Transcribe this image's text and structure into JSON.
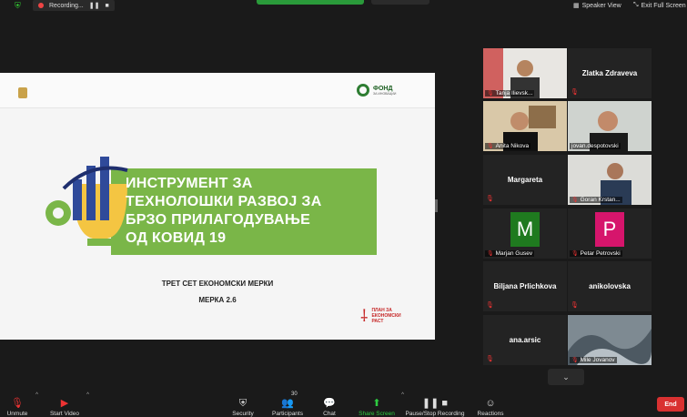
{
  "topbar": {
    "recording_label": "Recording...",
    "speaker_view": "Speaker View",
    "exit_fullscreen": "Exit Full Screen"
  },
  "slide": {
    "title_lines": [
      "ИНСТРУМЕНТ ЗА",
      "ТЕХНОЛОШКИ РАЗВОЈ ЗА",
      "БРЗО ПРИЛАГОДУВАЊЕ",
      "ОД КОВИД 19"
    ],
    "subtitle": "ТРЕТ СЕТ ЕКОНОМСКИ МЕРКИ",
    "measure": "МЕРКА 2.6",
    "fund_logo_main": "ФОНД",
    "fund_logo_sub": "ЗА ИНОВАЦИИ",
    "plan_logo_lines": [
      "ПЛАН ЗА",
      "ЕКОНОМСКИ",
      "РАСТ"
    ],
    "accent_green": "#7ab648"
  },
  "participants": [
    {
      "name": "Tanja Ilievsk...",
      "type": "video"
    },
    {
      "name": "Zlatka Zdraveva",
      "type": "name"
    },
    {
      "name": "Anita Nikova",
      "type": "video"
    },
    {
      "name": "jovan.despotovski",
      "type": "video",
      "active": true
    },
    {
      "name": "Margareta",
      "type": "name"
    },
    {
      "name": "Goran Krstan...",
      "type": "video"
    },
    {
      "name": "Marjan Gusev",
      "type": "avatar",
      "initial": "M",
      "color": "#1f7a1f"
    },
    {
      "name": "Petar Petrovski",
      "type": "avatar",
      "initial": "P",
      "color": "#d6156c"
    },
    {
      "name": "Biljana Prlichkova",
      "type": "name"
    },
    {
      "name": "anikolovska",
      "type": "name"
    },
    {
      "name": "ana.arsic",
      "type": "name"
    },
    {
      "name": "Mile Jovanov",
      "type": "video"
    }
  ],
  "toolbar": {
    "unmute": "Unmute",
    "start_video": "Start Video",
    "security": "Security",
    "participants": "Participants",
    "participants_count": "30",
    "chat": "Chat",
    "share_screen": "Share Screen",
    "pause_recording": "Pause/Stop Recording",
    "reactions": "Reactions",
    "end": "End"
  }
}
